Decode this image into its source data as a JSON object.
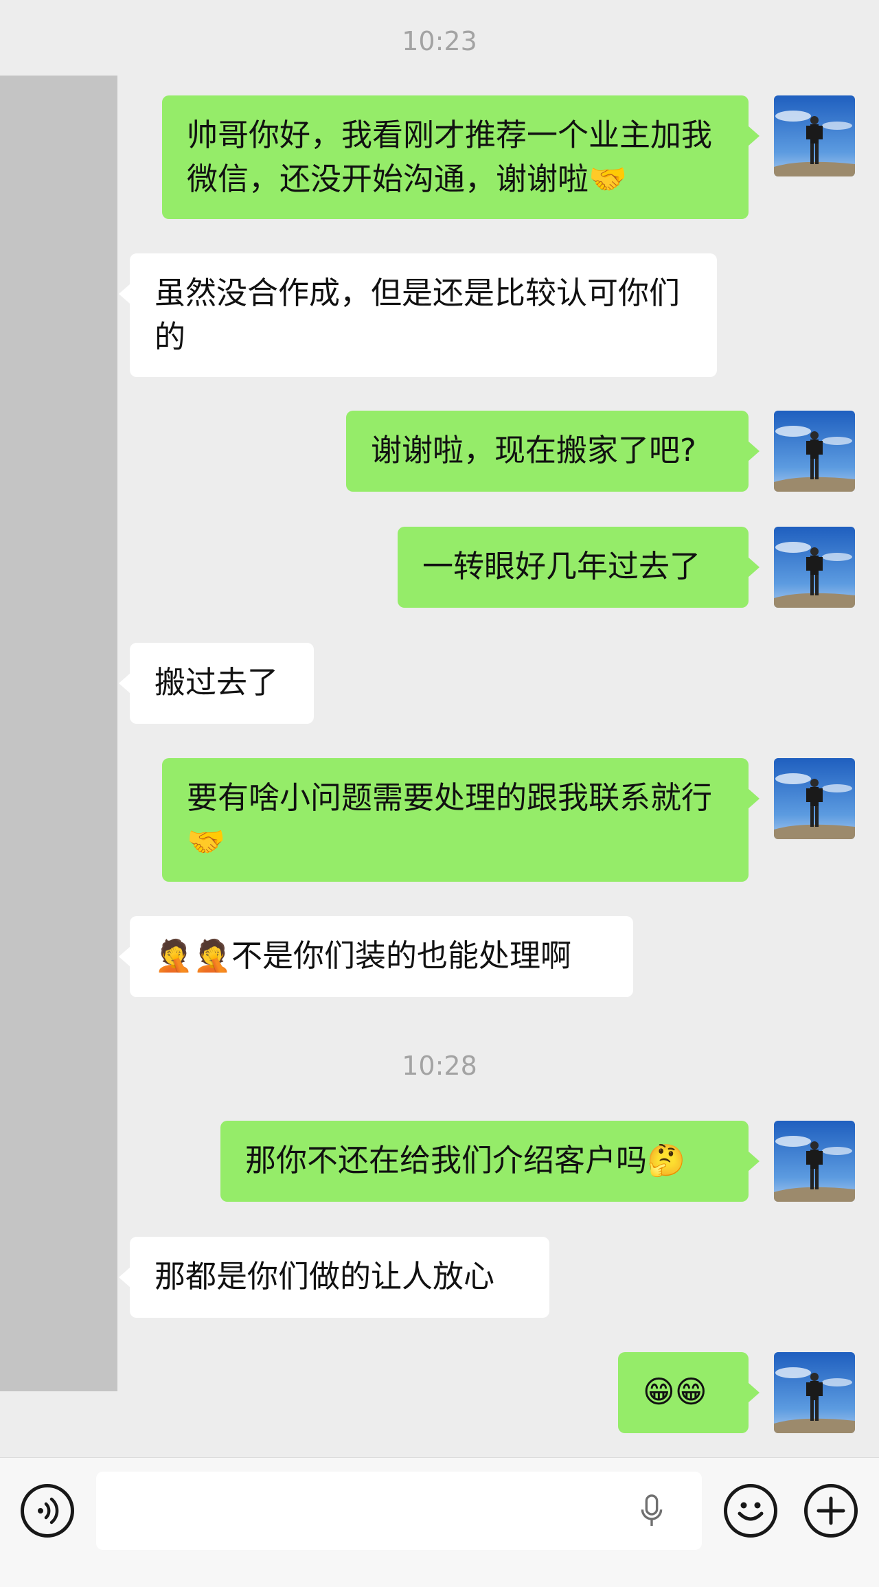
{
  "timestamps": [
    "10:23",
    "10:28"
  ],
  "messages": [
    {
      "from": "me",
      "text": "帅哥你好，我看刚才推荐一个业主加我微信，还没开始沟通，谢谢啦🤝"
    },
    {
      "from": "other",
      "text": "虽然没合作成，但是还是比较认可你们的"
    },
    {
      "from": "me",
      "text": "谢谢啦，现在搬家了吧?"
    },
    {
      "from": "me",
      "text": "一转眼好几年过去了"
    },
    {
      "from": "other",
      "text": "搬过去了"
    },
    {
      "from": "me",
      "text": "要有啥小问题需要处理的跟我联系就行🤝"
    },
    {
      "from": "other",
      "text": "🤦🤦不是你们装的也能处理啊"
    },
    {
      "from": "me",
      "text": "那你不还在给我们介绍客户吗🤔"
    },
    {
      "from": "other",
      "text": "那都是你们做的让人放心"
    },
    {
      "from": "me",
      "text": "😁😁"
    }
  ],
  "input_bar": {
    "voice_icon": "voice-toggle-icon",
    "mic_icon": "microphone-icon",
    "emoji_icon": "emoji-icon",
    "plus_icon": "plus-icon"
  },
  "colors": {
    "outgoing_bubble": "#95ec69",
    "incoming_bubble": "#ffffff",
    "background": "#ededed"
  }
}
